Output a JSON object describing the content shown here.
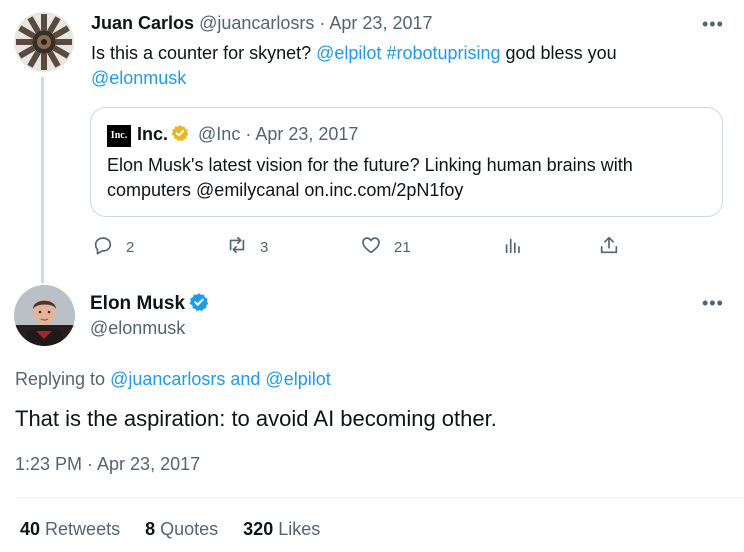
{
  "parent": {
    "name": "Juan Carlos",
    "handle": "@juancarlosrs",
    "separator": "·",
    "date": "Apr 23, 2017",
    "text_prefix": "Is this a counter for skynet? ",
    "mention1": "@elpilot",
    "hashtag": "#robotuprising",
    "text_middle": " god bless you",
    "mention2": "@elonmusk",
    "more": "•••"
  },
  "quote": {
    "logo_text": "Inc.",
    "name": "Inc.",
    "handle": "@Inc",
    "separator": "·",
    "date": "Apr 23, 2017",
    "text": "Elon Musk's latest vision for the future? Linking human brains with computers @emilycanal on.inc.com/2pN1foy"
  },
  "actions": {
    "replies": "2",
    "retweets": "3",
    "likes": "21"
  },
  "main": {
    "name": "Elon Musk",
    "handle": "@elonmusk",
    "more": "•••",
    "replying_prefix": "Replying to ",
    "replying_user1": "@juancarlosrs",
    "replying_and": " and ",
    "replying_user2": "@elpilot",
    "text": "That is the aspiration: to avoid AI becoming other.",
    "timestamp": "1:23 PM · Apr 23, 2017"
  },
  "stats": {
    "retweets_count": "40",
    "retweets_label": "Retweets",
    "quotes_count": "8",
    "quotes_label": "Quotes",
    "likes_count": "320",
    "likes_label": "Likes"
  },
  "colors": {
    "link": "#1d9bf0",
    "muted": "#536471",
    "verified_gold": "#e8b829",
    "verified_blue": "#1d9bf0"
  },
  "icons": [
    "reply-icon",
    "retweet-icon",
    "like-icon",
    "views-icon",
    "share-icon",
    "more-icon",
    "verified-badge-icon"
  ]
}
